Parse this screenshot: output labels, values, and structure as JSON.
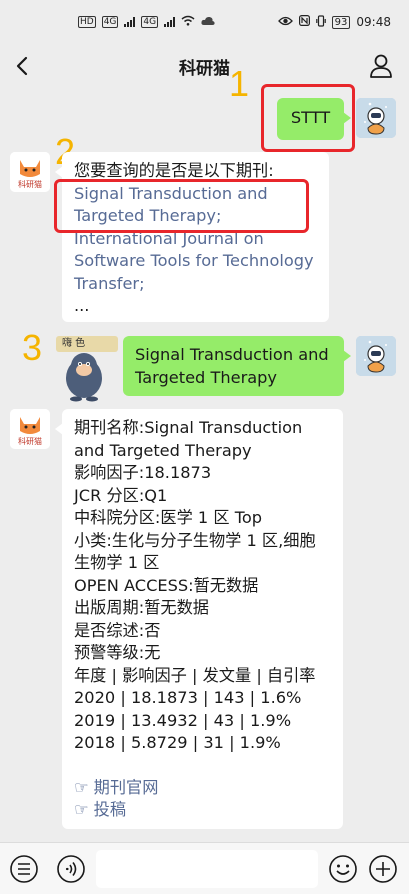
{
  "status_bar": {
    "left_chips": [
      "HD",
      "4G",
      "4G"
    ],
    "battery": "93",
    "time": "09:48"
  },
  "nav": {
    "title": "科研猫"
  },
  "annotations": {
    "n1": "1",
    "n2": "2",
    "n3": "3",
    "color": "#f5b400",
    "box_color": "#e8262b"
  },
  "messages": {
    "m1_text": "STTT",
    "m2": {
      "intro": "您要查询的是否是以下期刊:",
      "option1_line1": "Signal Transduction and",
      "option1_line2": "Targeted Therapy;",
      "option2_line1": "International Journal on",
      "option2_line2": "Software Tools for Technology",
      "option2_line3": "Transfer;",
      "ellipsis": "..."
    },
    "sticker_tag": "嗨 色",
    "m3": {
      "line1": "Signal Transduction and",
      "line2": "Targeted Therapy"
    },
    "m4": {
      "l1": "期刊名称:Signal Transduction",
      "l2": "and Targeted Therapy",
      "l3": "影响因子:18.1873",
      "l4": "JCR 分区:Q1",
      "l5": "中科院分区:医学 1 区 Top",
      "l6": "小类:生化与分子生物学 1 区,细胞",
      "l7": "生物学 1 区",
      "l8": "OPEN ACCESS:暂无数据",
      "l9": "出版周期:暂无数据",
      "l10": "是否综述:否",
      "l11": "预警等级:无",
      "l12": "年度 | 影响因子 | 发文量 | 自引率",
      "l13": "2020 | 18.1873 | 143 | 1.6%",
      "l14": "2019 | 13.4932 | 43 | 1.9%",
      "l15": "2018 | 5.8729 | 31 | 1.9%",
      "link1": "☞ 期刊官网",
      "link2": "☞ 投稿"
    }
  },
  "colors": {
    "bubble_green": "#95ec69",
    "link": "#576b95",
    "background": "#ededed"
  },
  "icons": {
    "back": "chevron-left-icon",
    "user": "user-icon",
    "voice": "voice-icon",
    "menu": "menu-list-icon",
    "emoji": "emoji-icon",
    "plus": "plus-icon"
  }
}
